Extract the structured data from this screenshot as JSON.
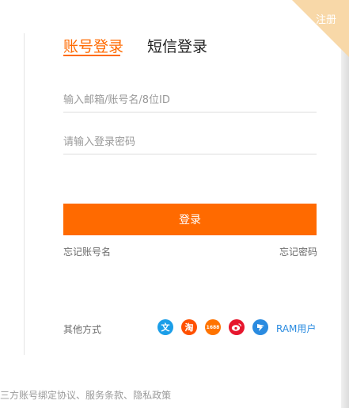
{
  "corner": {
    "label": "注册",
    "color": "#f8d8a8"
  },
  "tabs": [
    {
      "label": "账号登录",
      "active": true
    },
    {
      "label": "短信登录",
      "active": false
    }
  ],
  "form": {
    "account_placeholder": "输入邮箱/账号名/8位ID",
    "account_value": "",
    "password_placeholder": "请输入登录密码",
    "password_value": ""
  },
  "login_button": {
    "label": "登录",
    "color": "#ff6a00"
  },
  "links": {
    "forgot_account": "忘记账号名",
    "forgot_password": "忘记密码"
  },
  "other": {
    "label": "其他方式",
    "providers": [
      {
        "icon": "alipay-icon",
        "glyph": "文",
        "color": "#1b9ee8"
      },
      {
        "icon": "taobao-icon",
        "glyph": "淘",
        "color": "#ff5000"
      },
      {
        "icon": "1688-icon",
        "glyph": "1688",
        "color": "#ff7300"
      },
      {
        "icon": "weibo-icon",
        "glyph": "",
        "color": "#e6162d"
      },
      {
        "icon": "dingtalk-icon",
        "glyph": "",
        "color": "#2a8be0"
      }
    ],
    "ram_label": "RAM用户"
  },
  "footer": {
    "prefix": "三方账号绑定协议",
    "sep1": "、",
    "terms": "服务条款",
    "sep2": "、",
    "privacy": "隐私政策"
  },
  "accent_color": "#ff6a00",
  "link_color": "#2a8be0"
}
